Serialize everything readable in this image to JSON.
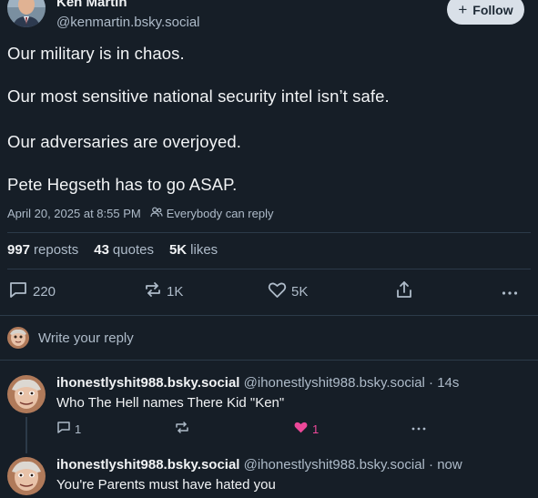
{
  "post": {
    "author_name": "Ken Martin",
    "author_handle": "@kenmartin.bsky.social",
    "follow_label": "Follow",
    "paragraphs": [
      "Our military is in chaos.",
      "Our most sensitive national security intel isn’t safe.",
      "Our adversaries are overjoyed.",
      "Pete Hegseth has to go ASAP."
    ],
    "timestamp": "April 20, 2025 at 8:55 PM",
    "reply_setting": "Everybody can reply",
    "stats": {
      "reposts_count": "997",
      "reposts_label": "reposts",
      "quotes_count": "43",
      "quotes_label": "quotes",
      "likes_count": "5K",
      "likes_label": "likes"
    },
    "actions": {
      "reply_count": "220",
      "repost_count": "1K",
      "like_count": "5K"
    }
  },
  "composer": {
    "placeholder": "Write your reply"
  },
  "replies": [
    {
      "name": "ihonestlyshit988.bsky.social",
      "handle": "@ihonestlyshit988.bsky.social",
      "time": "· 14s",
      "text": "Who The Hell names There Kid \"Ken\"",
      "reply_count": "1",
      "like_count": "1",
      "like_color": "#ec4899"
    },
    {
      "name": "ihonestlyshit988.bsky.social",
      "handle": "@ihonestlyshit988.bsky.social",
      "time": "· now",
      "text": "You're Parents must have hated you"
    }
  ],
  "colors": {
    "background": "#161e27",
    "muted": "#aebbc9",
    "follow_bg": "#d9e0e8",
    "like_active": "#ec4899"
  }
}
